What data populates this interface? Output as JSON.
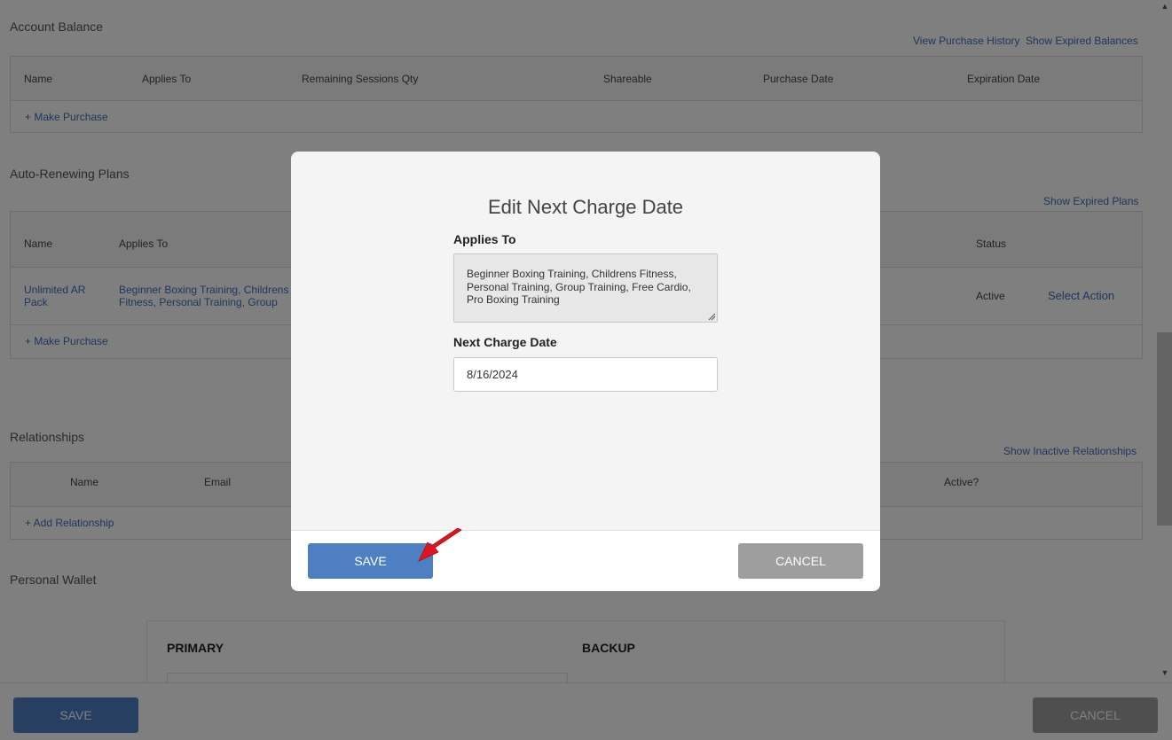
{
  "account_balance": {
    "title": "Account Balance",
    "links": [
      "View Purchase History",
      "Show Expired Balances"
    ],
    "columns": [
      "Name",
      "Applies To",
      "Remaining Sessions Qty",
      "Shareable",
      "Purchase Date",
      "Expiration Date"
    ],
    "add_link": "+ Make Purchase"
  },
  "auto_renewing": {
    "title": "Auto-Renewing Plans",
    "links": [
      "Show Expired Plans"
    ],
    "columns": [
      "Name",
      "Applies To",
      "Status"
    ],
    "row": {
      "name": "Unlimited AR Pack",
      "applies_to": "Beginner Boxing Training, Childrens Fitness, Personal Training, Group Training, Free Cardio",
      "status": "Active",
      "action": "Select Action"
    },
    "add_link": "+ Make Purchase"
  },
  "relationships": {
    "title": "Relationships",
    "links": [
      "Show Inactive Relationships"
    ],
    "columns": [
      "Name",
      "Email",
      "Active?"
    ],
    "add_link": "+ Add Relationship"
  },
  "wallet": {
    "title": "Personal Wallet",
    "primary_label": "PRIMARY",
    "backup_label": "BACKUP"
  },
  "bottom_bar": {
    "save_label": "SAVE",
    "cancel_label": "CANCEL"
  },
  "modal": {
    "title": "Edit Next Charge Date",
    "applies_to_label": "Applies To",
    "applies_to_value": "Beginner Boxing Training, Childrens Fitness, Personal Training, Group Training, Free Cardio, Pro Boxing Training",
    "next_charge_label": "Next Charge Date",
    "next_charge_value": "8/16/2024",
    "save_label": "SAVE",
    "cancel_label": "CANCEL"
  },
  "colors": {
    "primary_button": "#4f7fc3",
    "cancel_button": "#9e9e9e",
    "link": "#3b6fb6",
    "annotation_arrow": "#e0141e"
  }
}
